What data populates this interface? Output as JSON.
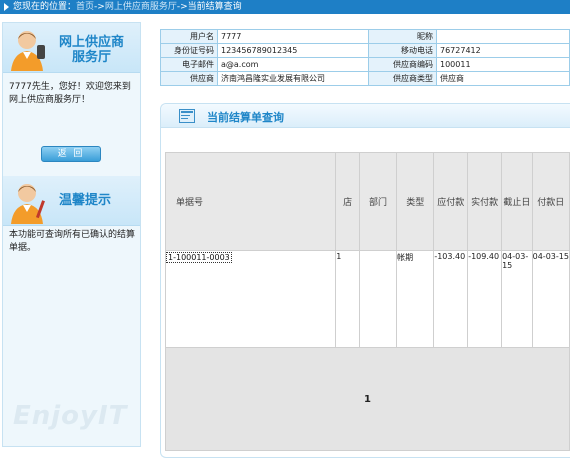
{
  "breadcrumb": {
    "prefix": "您现在的位置：",
    "items": [
      "首页",
      "网上供应商服务厅",
      "当前结算查询"
    ],
    "separator": "->"
  },
  "left_panel": {
    "service_title_line1": "网上供应商",
    "service_title_line2": "服务厅",
    "welcome_text": "7777先生，您好！欢迎您来到网上供应商服务厅！",
    "return_button": "返 回",
    "tips_title": "温馨提示",
    "tips_text": "本功能可查询所有已确认的结算单据。",
    "watermark": "EnjoyIT"
  },
  "info": {
    "username_label": "用户名",
    "username": "7777",
    "nickname_label": "昵称",
    "nickname": "",
    "id_label": "身份证号码",
    "id": "123456789012345",
    "mobile_label": "移动电话",
    "mobile": "76727412",
    "email_label": "电子邮件",
    "email": "a@a.com",
    "supplier_code_label": "供应商编码",
    "supplier_code": "100011",
    "supplier_label": "供应商",
    "supplier": "济南鸿昌隆实业发展有限公司",
    "supplier_type_label": "供应商类型",
    "supplier_type": "供应商"
  },
  "section": {
    "title": "当前结算单查询"
  },
  "table": {
    "columns": [
      "单据号",
      "店",
      "部门",
      "类型",
      "应付款",
      "实付款",
      "截止日",
      "付款日"
    ],
    "rows": [
      {
        "bill_no": "1-100011-0003",
        "store": "1",
        "dept": "",
        "type": "帐期",
        "payable": "-103.40",
        "paid": "-109.40",
        "cutoff": "04-03-15",
        "pay_date": "04-03-15"
      }
    ],
    "page": "1"
  },
  "colors": {
    "topbar": "#1e7fc6",
    "accent": "#1f86c8",
    "panel_bg": "#eef7fc"
  }
}
